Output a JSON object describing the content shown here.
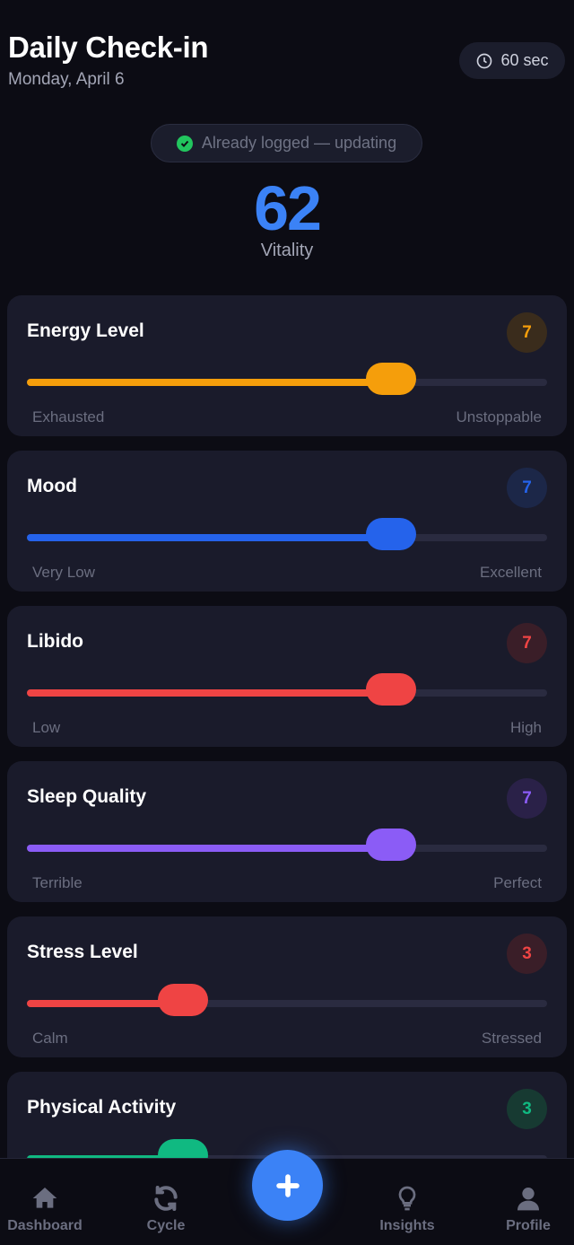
{
  "header": {
    "title": "Daily Check-in",
    "date": "Monday, April 6",
    "timer": "60 sec"
  },
  "status": {
    "text": "Already logged — updating"
  },
  "vitality": {
    "score": "62",
    "label": "Vitality"
  },
  "metrics": [
    {
      "name": "Energy Level",
      "value": "7",
      "fraction": 0.7,
      "low": "Exhausted",
      "high": "Unstoppable",
      "color": "#f59e0b",
      "badge_bg": "#3a2c1c"
    },
    {
      "name": "Mood",
      "value": "7",
      "fraction": 0.7,
      "low": "Very Low",
      "high": "Excellent",
      "color": "#2563eb",
      "badge_bg": "#1c2748"
    },
    {
      "name": "Libido",
      "value": "7",
      "fraction": 0.7,
      "low": "Low",
      "high": "High",
      "color": "#ef4444",
      "badge_bg": "#3a1e28"
    },
    {
      "name": "Sleep Quality",
      "value": "7",
      "fraction": 0.7,
      "low": "Terrible",
      "high": "Perfect",
      "color": "#8b5cf6",
      "badge_bg": "#2a2148"
    },
    {
      "name": "Stress Level",
      "value": "3",
      "fraction": 0.3,
      "low": "Calm",
      "high": "Stressed",
      "color": "#ef4444",
      "badge_bg": "#3a1e28"
    },
    {
      "name": "Physical Activity",
      "value": "3",
      "fraction": 0.3,
      "low": "",
      "high": "",
      "color": "#10b981",
      "badge_bg": "#173a32"
    }
  ],
  "nav": {
    "items": [
      {
        "label": "Dashboard",
        "icon": "home-icon"
      },
      {
        "label": "Cycle",
        "icon": "refresh-icon"
      },
      {
        "label": "Insights",
        "icon": "lightbulb-icon"
      },
      {
        "label": "Profile",
        "icon": "user-icon"
      }
    ],
    "fab_icon": "plus-icon"
  }
}
